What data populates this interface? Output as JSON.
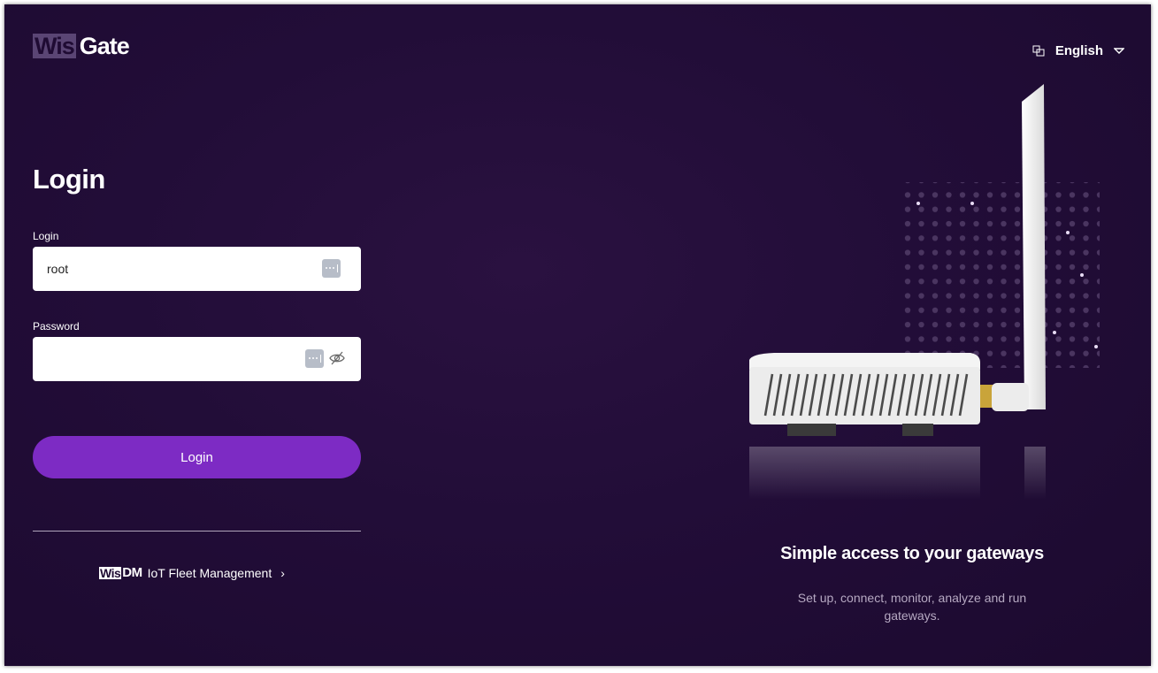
{
  "brand": {
    "logo_wis": "Wis",
    "logo_gate": "Gate"
  },
  "language": {
    "icon": "translate-icon",
    "selected": "English",
    "caret": "caret-down-icon"
  },
  "login_form": {
    "title": "Login",
    "username_label": "Login",
    "username_value": "root",
    "password_label": "Password",
    "password_value": "",
    "submit_label": "Login"
  },
  "wisdm_link": {
    "logo_wis": "Wis",
    "logo_dm": "DM",
    "label": "IoT Fleet Management",
    "chevron": "›"
  },
  "hero": {
    "title": "Simple access to your gateways",
    "subtitle": "Set up, connect, monitor, analyze and run gateways."
  },
  "colors": {
    "background": "#220d38",
    "primary_button": "#7d2bc4",
    "text": "#ffffff",
    "muted_text": "#b6a9c2"
  }
}
